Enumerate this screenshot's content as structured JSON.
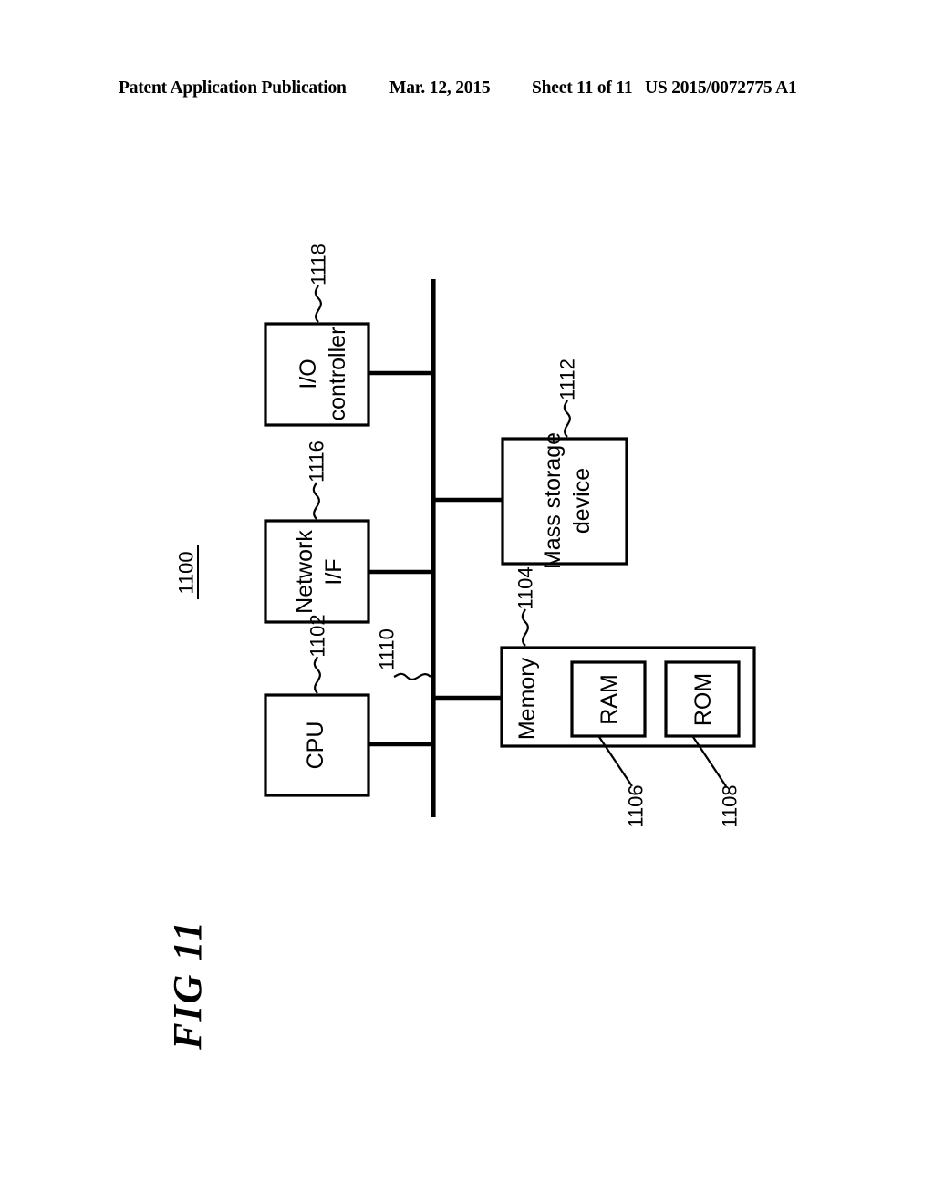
{
  "header": {
    "publication": "Patent Application Publication",
    "date": "Mar. 12, 2015",
    "sheet": "Sheet 11 of 11",
    "doc_number": "US 2015/0072775 A1"
  },
  "figure": {
    "caption": "FIG 11",
    "system_ref": "1100"
  },
  "diagram": {
    "type": "block-diagram",
    "orientation": "rotated-90-ccw",
    "bus": {
      "label": "1110",
      "name": "system-bus"
    },
    "blocks": [
      {
        "id": "io-controller",
        "label": "I/O controller",
        "label_lines": [
          "I/O",
          "controller"
        ],
        "ref": "1118",
        "side": "left"
      },
      {
        "id": "network-if",
        "label": "Network I/F",
        "label_lines": [
          "Network",
          "I/F"
        ],
        "ref": "1116",
        "side": "left"
      },
      {
        "id": "cpu",
        "label": "CPU",
        "label_lines": [
          "CPU"
        ],
        "ref": "1102",
        "side": "left"
      },
      {
        "id": "mass-storage",
        "label": "Mass storage device",
        "label_lines": [
          "Mass storage",
          "device"
        ],
        "ref": "1112",
        "side": "right"
      },
      {
        "id": "memory",
        "label": "Memory",
        "label_lines": [
          "Memory"
        ],
        "ref": "1104",
        "side": "right"
      }
    ],
    "sub_blocks": [
      {
        "id": "ram",
        "label": "RAM",
        "ref": "1106",
        "parent": "memory"
      },
      {
        "id": "rom",
        "label": "ROM",
        "ref": "1108",
        "parent": "memory"
      }
    ],
    "colors": {
      "stroke": "#000000",
      "fill": "#ffffff",
      "background": "#ffffff"
    }
  }
}
